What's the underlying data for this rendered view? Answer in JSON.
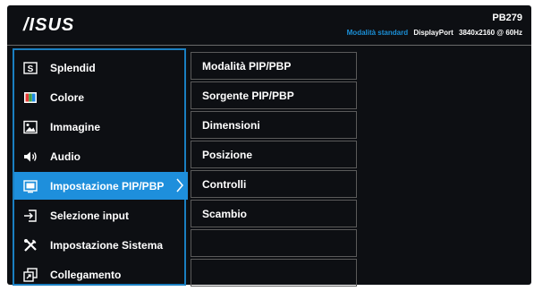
{
  "brand": {
    "logo_text": "/ISUS"
  },
  "header": {
    "model": "PB279",
    "mode": "Modalità standard",
    "input": "DisplayPort",
    "resolution": "3840x2160 @ 60Hz"
  },
  "menu": {
    "items": [
      {
        "label": "Splendid",
        "icon": "splendid-icon"
      },
      {
        "label": "Colore",
        "icon": "color-icon"
      },
      {
        "label": "Immagine",
        "icon": "image-icon"
      },
      {
        "label": "Audio",
        "icon": "speaker-icon"
      },
      {
        "label": "Impostazione PIP/PBP",
        "icon": "pip-icon",
        "selected": true
      },
      {
        "label": "Selezione input",
        "icon": "input-icon"
      },
      {
        "label": "Impostazione Sistema",
        "icon": "wrench-screwdriver-icon"
      },
      {
        "label": "Collegamento",
        "icon": "shortcut-icon"
      }
    ]
  },
  "submenu": {
    "items": [
      {
        "label": "Modalità PIP/PBP"
      },
      {
        "label": "Sorgente PIP/PBP"
      },
      {
        "label": "Dimensioni"
      },
      {
        "label": "Posizione"
      },
      {
        "label": "Controlli"
      },
      {
        "label": "Scambio"
      },
      {
        "label": ""
      },
      {
        "label": ""
      }
    ]
  },
  "colors": {
    "accent": "#1e8fdc",
    "background": "#0d0f13",
    "mode_text": "#1b8fd6"
  }
}
